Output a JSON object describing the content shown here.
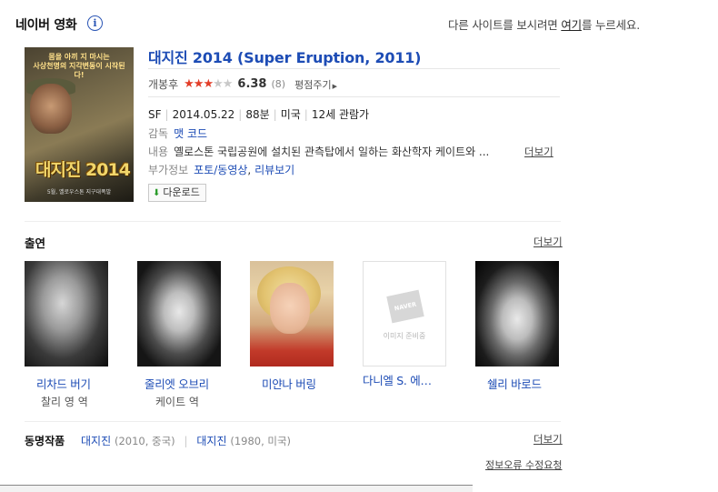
{
  "header": {
    "title": "네이버 영화",
    "info_icon": "i",
    "right_prefix": "다른 사이트를 보시려면 ",
    "right_link": "여기",
    "right_suffix": "를 누르세요."
  },
  "poster": {
    "tagline": "몸을 아끼 지 마시는\n사상천명의 지각변동이 시작된다!",
    "title_text": "대지진 2014",
    "bottom_text": "5월, 옐로우스톤 지구대폭발"
  },
  "movie": {
    "title": "대지진 2014 (Super Eruption, 2011)",
    "rating_label": "개봉후",
    "stars_filled": 3,
    "stars_total": 5,
    "score": "6.38",
    "count": "(8)",
    "rate_button": "평점주기",
    "genre": "SF",
    "release_date": "2014.05.22",
    "runtime": "88분",
    "country": "미국",
    "age_rating": "12세 관람가",
    "director_label": "감독",
    "director": "맷 코드",
    "plot_label": "내용",
    "plot": "옐로스톤 국립공원에 설치된 관측탑에서 일하는 화산학자 케이트와 ...",
    "more": "더보기",
    "extra_label": "부가정보",
    "extra_photos": "포토/동영상",
    "extra_reviews": "리뷰보기",
    "download": "다운로드",
    "colors": {
      "link": "#1d4cb5",
      "star": "#e33d28"
    }
  },
  "cast": {
    "title": "출연",
    "more": "더보기",
    "members": [
      {
        "name": "리차드 버기",
        "role": "찰리 영 역"
      },
      {
        "name": "줄리엣 오브리",
        "role": "케이트 역"
      },
      {
        "name": "미얀나 버링",
        "role": ""
      },
      {
        "name": "다니엘 S. 에…",
        "role": "",
        "placeholder_logo": "NAVER",
        "placeholder_text": "이미지 준비중"
      },
      {
        "name": "쉘리 바로드",
        "role": ""
      }
    ]
  },
  "same_title": {
    "title": "동명작품",
    "items": [
      {
        "name": "대지진",
        "info": "(2010, 중국)"
      },
      {
        "name": "대지진",
        "info": "(1980, 미국)"
      }
    ],
    "more": "더보기"
  },
  "footer": {
    "error_report": "정보오류 수정요청"
  }
}
